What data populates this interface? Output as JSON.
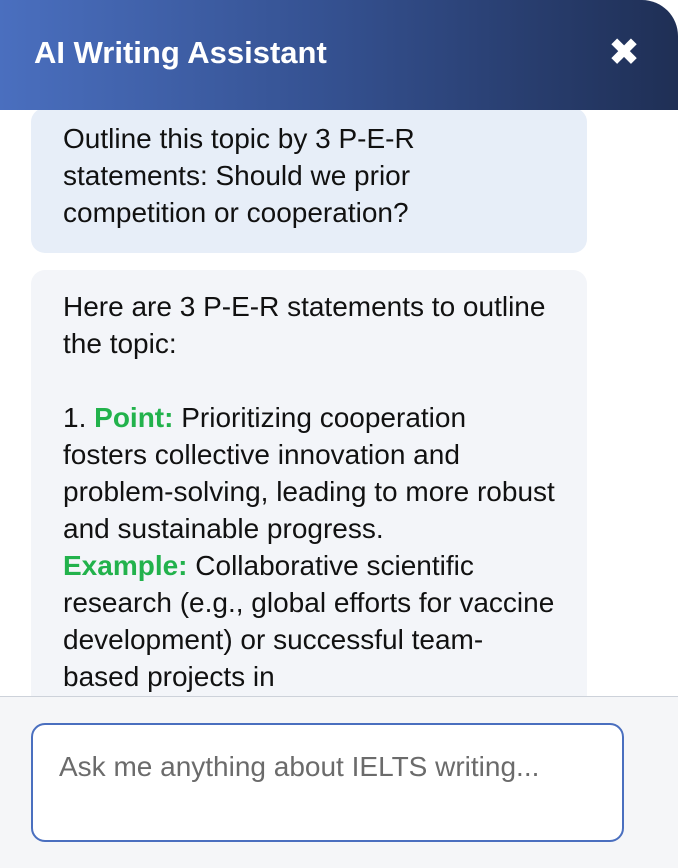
{
  "header": {
    "title": "AI Writing Assistant",
    "close_icon": "close-icon"
  },
  "messages": {
    "user": {
      "text": "Outline this topic by 3 P-E-R statements: Should we prior competition or cooperation?"
    },
    "assistant": {
      "intro": "Here are 3 P-E-R statements to outline the topic:",
      "item1_number": "1.",
      "point_label": "Point:",
      "point_text": "Prioritizing cooperation fosters collective innovation and problem-solving, leading to more robust and sustainable progress.",
      "example_label": "Example:",
      "example_text": "Collaborative scientific research (e.g., global efforts for vaccine development) or successful team-based projects in"
    }
  },
  "input": {
    "placeholder": "Ask me anything about IELTS writing..."
  },
  "colors": {
    "header_start": "#4a6fbf",
    "header_end": "#1f2f55",
    "label_green": "#22b24c",
    "user_bubble": "#e7eef8",
    "assistant_bubble": "#f3f5f9"
  }
}
